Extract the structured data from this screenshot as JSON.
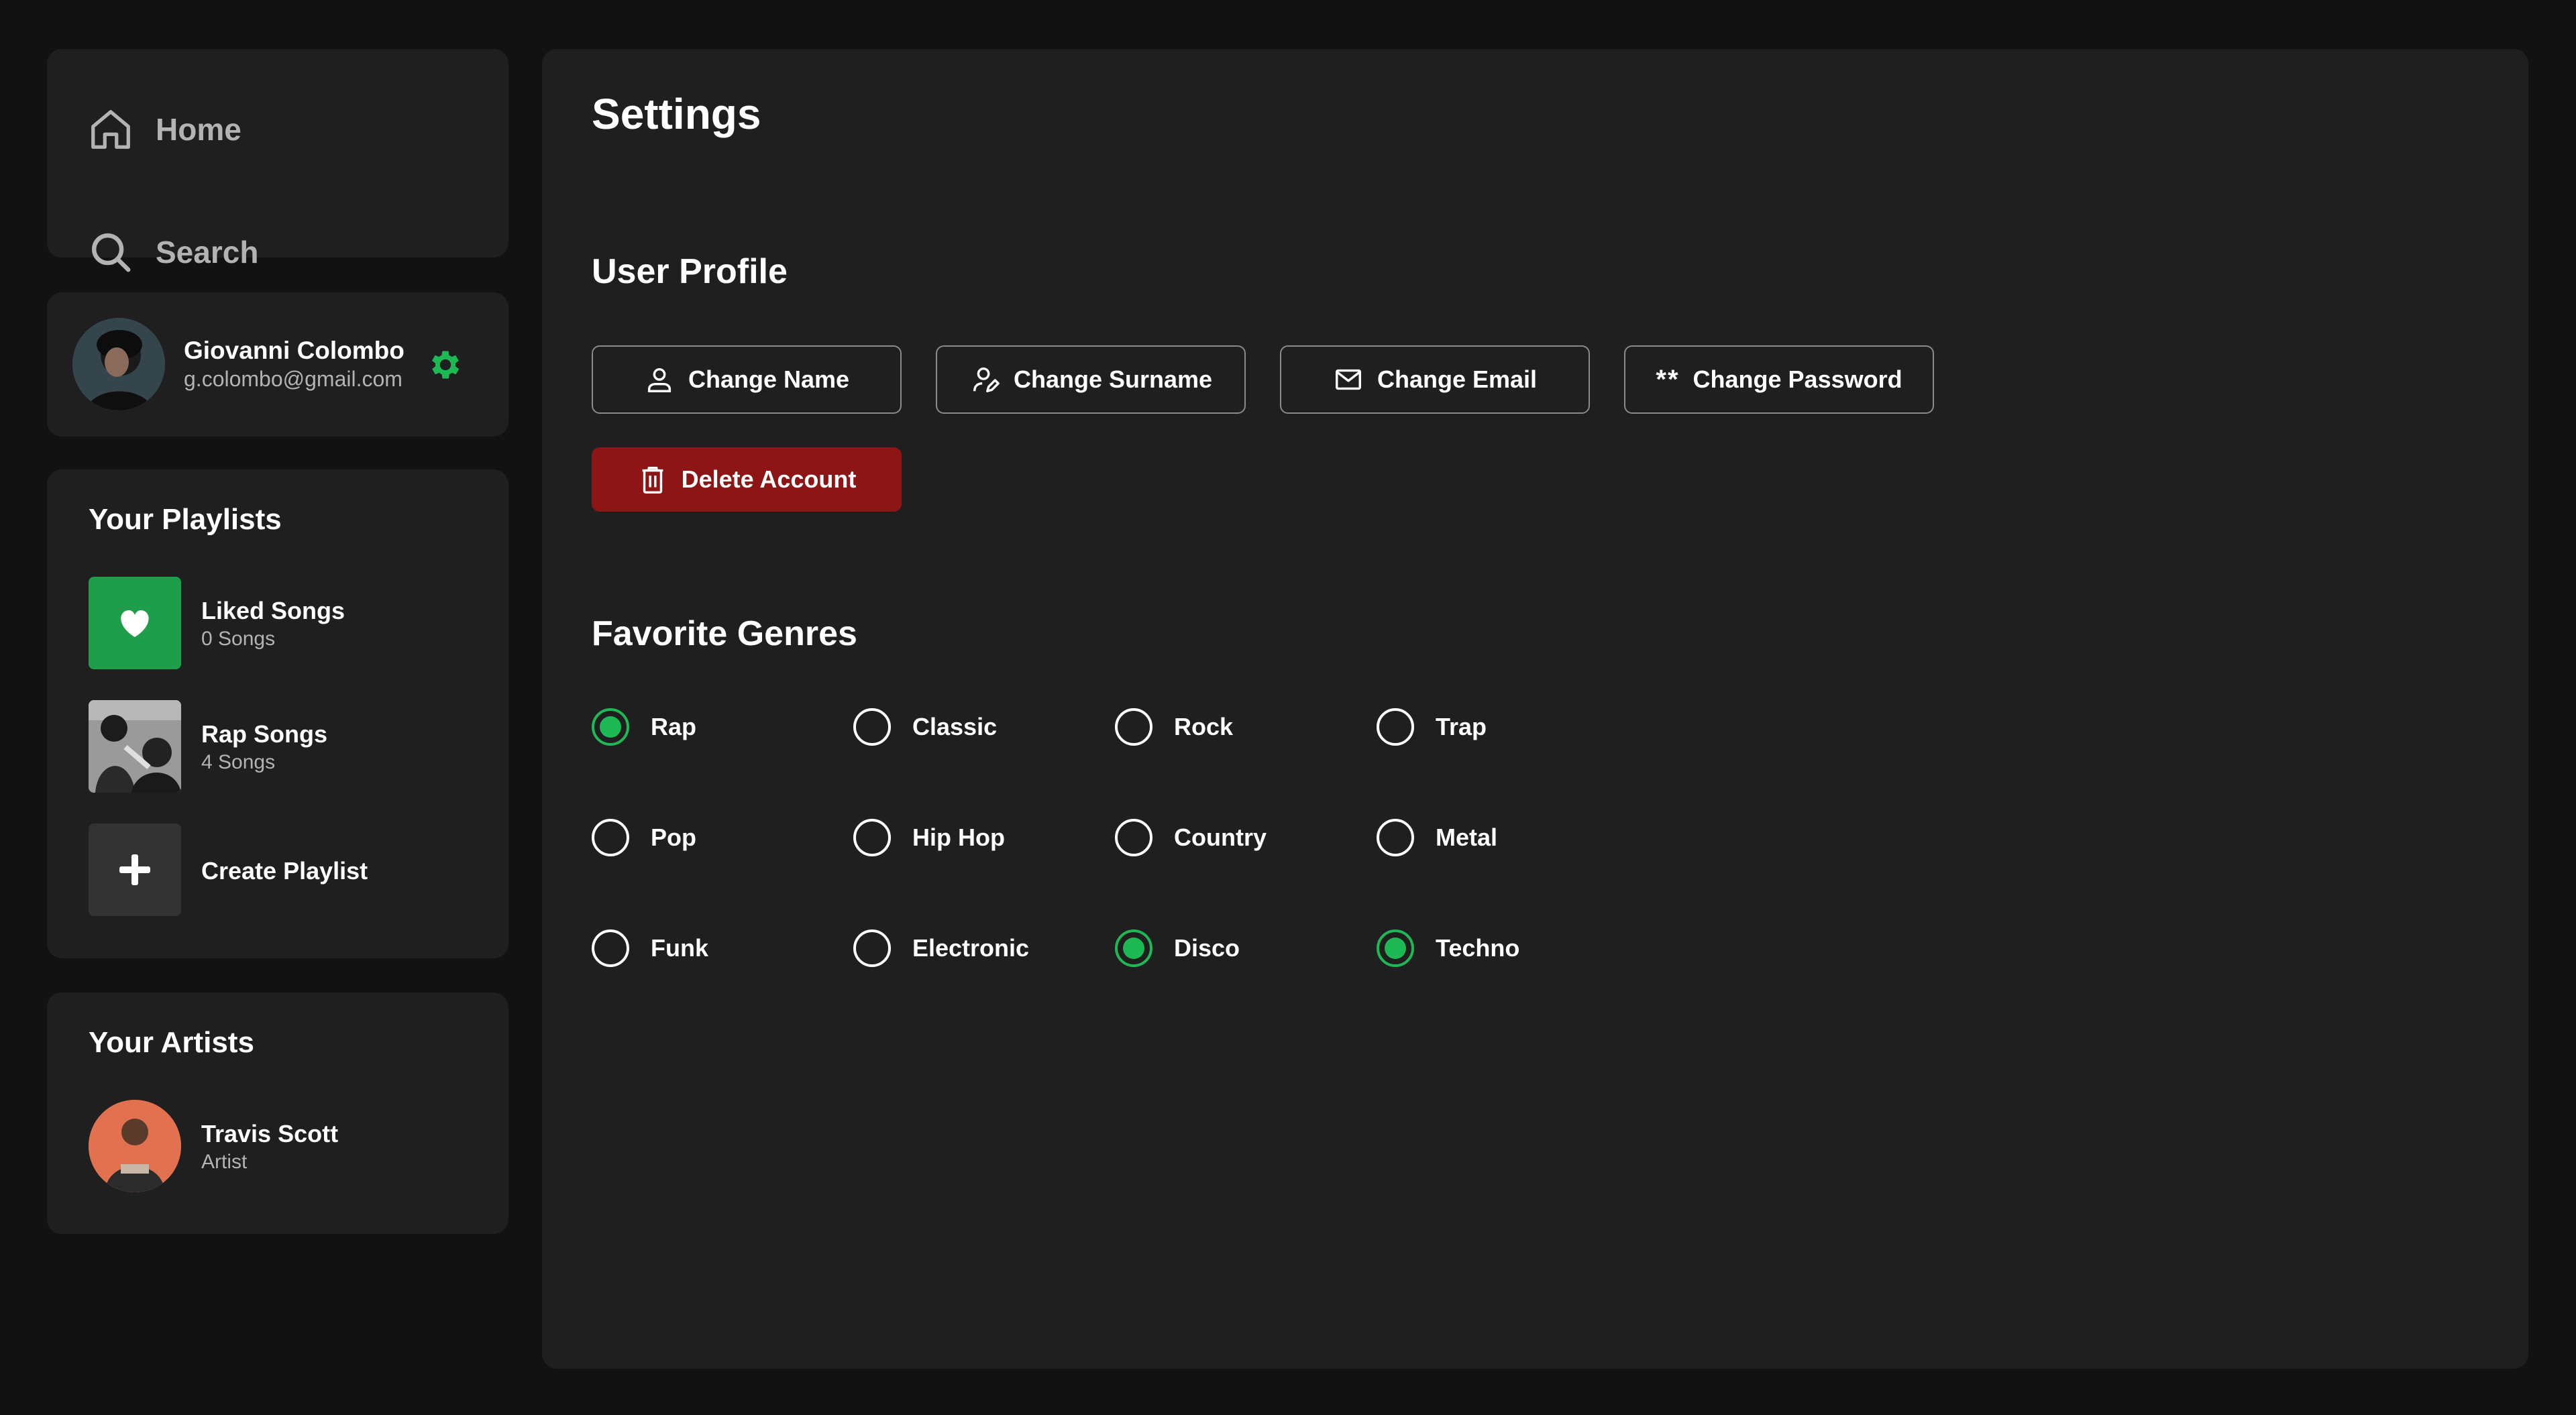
{
  "nav": {
    "home_label": "Home",
    "search_label": "Search"
  },
  "profile": {
    "name": "Giovanni Colombo",
    "email": "g.colombo@gmail.com"
  },
  "playlists": {
    "title": "Your Playlists",
    "items": [
      {
        "name": "Liked Songs",
        "subtitle": "0 Songs"
      },
      {
        "name": "Rap Songs",
        "subtitle": "4 Songs"
      },
      {
        "name": "Create Playlist"
      }
    ]
  },
  "artists": {
    "title": "Your Artists",
    "items": [
      {
        "name": "Travis Scott",
        "subtitle": "Artist"
      }
    ]
  },
  "main": {
    "title": "Settings",
    "user_profile": {
      "title": "User Profile",
      "buttons": {
        "change_name": "Change Name",
        "change_surname": "Change Surname",
        "change_email": "Change Email",
        "change_password": "Change Password",
        "password_icon_text": "**",
        "delete_account": "Delete Account"
      }
    },
    "genres": {
      "title": "Favorite Genres",
      "options": [
        {
          "label": "Rap",
          "checked": true
        },
        {
          "label": "Classic",
          "checked": false
        },
        {
          "label": "Rock",
          "checked": false
        },
        {
          "label": "Trap",
          "checked": false
        },
        {
          "label": "Pop",
          "checked": false
        },
        {
          "label": "Hip Hop",
          "checked": false
        },
        {
          "label": "Country",
          "checked": false
        },
        {
          "label": "Metal",
          "checked": false
        },
        {
          "label": "Funk",
          "checked": false
        },
        {
          "label": "Electronic",
          "checked": false
        },
        {
          "label": "Disco",
          "checked": true
        },
        {
          "label": "Techno",
          "checked": true
        }
      ]
    }
  },
  "colors": {
    "accent": "#1db954",
    "danger": "#8e1515",
    "background": "#121212",
    "card": "#1f1f1f"
  }
}
